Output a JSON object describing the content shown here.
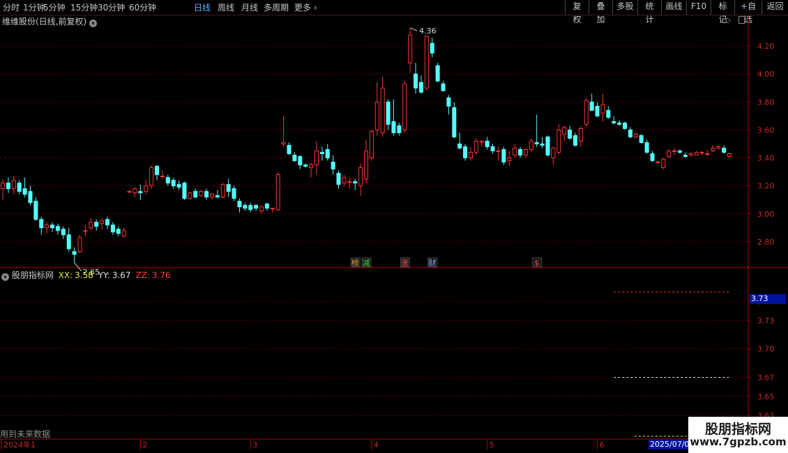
{
  "toolbar": {
    "periods": [
      "分时",
      "1分钟",
      "5分钟",
      "15分钟",
      "30分钟",
      "60分钟",
      "日线",
      "周线",
      "月线",
      "多周期",
      "更多"
    ],
    "active_period": "日线",
    "right_buttons": [
      "复权",
      "叠加",
      "多股",
      "统计",
      "画线",
      "F10",
      "标记",
      "+自选",
      "返回"
    ]
  },
  "main_panel": {
    "title": "维维股份(日线,前复权)",
    "high_label": "4.36",
    "low_label": "2.65",
    "event_badges": [
      {
        "text": "榜",
        "color": "#e0a040"
      },
      {
        "text": "减",
        "color": "#40d040"
      },
      {
        "text": "涨",
        "color": "#ff5050"
      },
      {
        "text": "财",
        "color": "#80a8ff"
      },
      {
        "text": "$",
        "color": "#ff4040"
      }
    ]
  },
  "indicator_panel": {
    "name": "股朋指标网",
    "xx_label": "XX:",
    "xx_value": "3.58",
    "yy_label": "YY:",
    "yy_value": "3.67",
    "zz_label": "ZZ:",
    "zz_value": "3.76",
    "current_value": "3.73",
    "footer_note": "用到未来数据"
  },
  "x_axis": {
    "labels": [
      "2024年1",
      "2",
      "3",
      "4",
      "5",
      "6"
    ],
    "current_date": "2025/07/0"
  },
  "watermark": {
    "line1": "股朋指标网",
    "line2": "www.7gpzb.com"
  },
  "colors": {
    "up": "#ff3232",
    "down": "#54ffff",
    "grid": "#7a0000",
    "active": "#5fb0ff"
  },
  "chart_data": {
    "type": "candlestick",
    "main_axis": {
      "ylim": [
        2.62,
        4.42
      ],
      "ticks": [
        "2.80",
        "3.00",
        "3.20",
        "3.40",
        "3.60",
        "3.80",
        "4.00",
        "4.20"
      ]
    },
    "indicator_axis": {
      "ylim": [
        3.605,
        3.785
      ],
      "ticks": [
        "3.63",
        "3.65",
        "3.67",
        "3.70",
        "3.73",
        "3.75"
      ]
    },
    "indicator_lines": {
      "XX": 3.58,
      "YY": 3.67,
      "ZZ": 3.76
    },
    "candles": [
      {
        "o": 3.18,
        "h": 3.25,
        "l": 3.1,
        "c": 3.22
      },
      {
        "o": 3.22,
        "h": 3.26,
        "l": 3.15,
        "c": 3.18
      },
      {
        "o": 3.18,
        "h": 3.27,
        "l": 3.14,
        "c": 3.24
      },
      {
        "o": 3.22,
        "h": 3.24,
        "l": 3.14,
        "c": 3.16
      },
      {
        "o": 3.18,
        "h": 3.26,
        "l": 3.12,
        "c": 3.14
      },
      {
        "o": 3.16,
        "h": 3.2,
        "l": 3.06,
        "c": 3.08
      },
      {
        "o": 3.09,
        "h": 3.12,
        "l": 2.95,
        "c": 2.96
      },
      {
        "o": 2.96,
        "h": 2.98,
        "l": 2.85,
        "c": 2.9
      },
      {
        "o": 2.9,
        "h": 2.94,
        "l": 2.86,
        "c": 2.92
      },
      {
        "o": 2.92,
        "h": 2.94,
        "l": 2.87,
        "c": 2.9
      },
      {
        "o": 2.91,
        "h": 2.93,
        "l": 2.85,
        "c": 2.88
      },
      {
        "o": 2.89,
        "h": 2.91,
        "l": 2.82,
        "c": 2.85
      },
      {
        "o": 2.85,
        "h": 2.9,
        "l": 2.73,
        "c": 2.75
      },
      {
        "o": 2.73,
        "h": 2.76,
        "l": 2.65,
        "c": 2.71
      },
      {
        "o": 2.73,
        "h": 2.85,
        "l": 2.72,
        "c": 2.83
      },
      {
        "o": 2.88,
        "h": 2.92,
        "l": 2.84,
        "c": 2.88
      },
      {
        "o": 2.9,
        "h": 2.97,
        "l": 2.88,
        "c": 2.94
      },
      {
        "o": 2.94,
        "h": 2.96,
        "l": 2.88,
        "c": 2.91
      },
      {
        "o": 2.93,
        "h": 2.97,
        "l": 2.89,
        "c": 2.95
      },
      {
        "o": 2.96,
        "h": 2.98,
        "l": 2.89,
        "c": 2.92
      },
      {
        "o": 2.92,
        "h": 2.94,
        "l": 2.85,
        "c": 2.87
      },
      {
        "o": 2.89,
        "h": 2.91,
        "l": 2.84,
        "c": 2.86
      },
      {
        "o": 2.84,
        "h": 2.9,
        "l": 2.83,
        "c": 2.88
      },
      {
        "o": 3.16,
        "h": 3.17,
        "l": 3.15,
        "c": 3.16
      },
      {
        "o": 3.15,
        "h": 3.19,
        "l": 3.12,
        "c": 3.18
      },
      {
        "o": 3.16,
        "h": 3.21,
        "l": 3.1,
        "c": 3.15
      },
      {
        "o": 3.16,
        "h": 3.24,
        "l": 3.14,
        "c": 3.2
      },
      {
        "o": 3.2,
        "h": 3.35,
        "l": 3.18,
        "c": 3.33
      },
      {
        "o": 3.34,
        "h": 3.35,
        "l": 3.24,
        "c": 3.28
      },
      {
        "o": 3.27,
        "h": 3.31,
        "l": 3.25,
        "c": 3.27
      },
      {
        "o": 3.26,
        "h": 3.28,
        "l": 3.2,
        "c": 3.22
      },
      {
        "o": 3.24,
        "h": 3.26,
        "l": 3.18,
        "c": 3.2
      },
      {
        "o": 3.21,
        "h": 3.24,
        "l": 3.17,
        "c": 3.19
      },
      {
        "o": 3.22,
        "h": 3.23,
        "l": 3.1,
        "c": 3.11
      },
      {
        "o": 3.11,
        "h": 3.16,
        "l": 3.1,
        "c": 3.15
      },
      {
        "o": 3.16,
        "h": 3.18,
        "l": 3.11,
        "c": 3.12
      },
      {
        "o": 3.13,
        "h": 3.17,
        "l": 3.12,
        "c": 3.16
      },
      {
        "o": 3.16,
        "h": 3.18,
        "l": 3.1,
        "c": 3.12
      },
      {
        "o": 3.12,
        "h": 3.15,
        "l": 3.1,
        "c": 3.14
      },
      {
        "o": 3.13,
        "h": 3.17,
        "l": 3.11,
        "c": 3.12
      },
      {
        "o": 3.12,
        "h": 3.22,
        "l": 3.11,
        "c": 3.21
      },
      {
        "o": 3.21,
        "h": 3.25,
        "l": 3.12,
        "c": 3.16
      },
      {
        "o": 3.18,
        "h": 3.2,
        "l": 3.09,
        "c": 3.11
      },
      {
        "o": 3.09,
        "h": 3.11,
        "l": 3.01,
        "c": 3.05
      },
      {
        "o": 3.06,
        "h": 3.08,
        "l": 3.02,
        "c": 3.04
      },
      {
        "o": 3.06,
        "h": 3.08,
        "l": 3.01,
        "c": 3.03
      },
      {
        "o": 3.06,
        "h": 3.07,
        "l": 3.02,
        "c": 3.04
      },
      {
        "o": 3.02,
        "h": 3.06,
        "l": 3.0,
        "c": 3.05
      },
      {
        "o": 3.07,
        "h": 3.08,
        "l": 3.02,
        "c": 3.04
      },
      {
        "o": 3.04,
        "h": 3.04,
        "l": 3.01,
        "c": 3.04
      },
      {
        "o": 3.03,
        "h": 3.3,
        "l": 3.02,
        "c": 3.28
      },
      {
        "o": 3.5,
        "h": 3.7,
        "l": 3.48,
        "c": 3.51
      },
      {
        "o": 3.49,
        "h": 3.51,
        "l": 3.42,
        "c": 3.43
      },
      {
        "o": 3.42,
        "h": 3.44,
        "l": 3.37,
        "c": 3.38
      },
      {
        "o": 3.41,
        "h": 3.42,
        "l": 3.32,
        "c": 3.35
      },
      {
        "o": 3.35,
        "h": 3.36,
        "l": 3.33,
        "c": 3.34
      },
      {
        "o": 3.33,
        "h": 3.37,
        "l": 3.26,
        "c": 3.35
      },
      {
        "o": 3.35,
        "h": 3.52,
        "l": 3.28,
        "c": 3.45
      },
      {
        "o": 3.44,
        "h": 3.48,
        "l": 3.38,
        "c": 3.43
      },
      {
        "o": 3.46,
        "h": 3.5,
        "l": 3.38,
        "c": 3.4
      },
      {
        "o": 3.37,
        "h": 3.42,
        "l": 3.28,
        "c": 3.32
      },
      {
        "o": 3.29,
        "h": 3.31,
        "l": 3.18,
        "c": 3.21
      },
      {
        "o": 3.22,
        "h": 3.28,
        "l": 3.2,
        "c": 3.26
      },
      {
        "o": 3.23,
        "h": 3.26,
        "l": 3.18,
        "c": 3.23
      },
      {
        "o": 3.23,
        "h": 3.25,
        "l": 3.17,
        "c": 3.22
      },
      {
        "o": 3.2,
        "h": 3.36,
        "l": 3.13,
        "c": 3.33
      },
      {
        "o": 3.25,
        "h": 3.53,
        "l": 3.22,
        "c": 3.45
      },
      {
        "o": 3.4,
        "h": 3.6,
        "l": 3.38,
        "c": 3.59
      },
      {
        "o": 3.6,
        "h": 3.94,
        "l": 3.56,
        "c": 3.8
      },
      {
        "o": 3.58,
        "h": 3.98,
        "l": 3.55,
        "c": 3.9
      },
      {
        "o": 3.8,
        "h": 3.82,
        "l": 3.6,
        "c": 3.64
      },
      {
        "o": 3.66,
        "h": 3.82,
        "l": 3.56,
        "c": 3.58
      },
      {
        "o": 3.63,
        "h": 3.65,
        "l": 3.56,
        "c": 3.58
      },
      {
        "o": 3.6,
        "h": 3.95,
        "l": 3.58,
        "c": 3.93
      },
      {
        "o": 4.08,
        "h": 4.33,
        "l": 4.01,
        "c": 4.28
      },
      {
        "o": 4.0,
        "h": 4.08,
        "l": 3.86,
        "c": 3.9
      },
      {
        "o": 3.94,
        "h": 3.99,
        "l": 3.86,
        "c": 3.87
      },
      {
        "o": 3.9,
        "h": 4.28,
        "l": 3.88,
        "c": 4.27
      },
      {
        "o": 4.22,
        "h": 4.26,
        "l": 4.12,
        "c": 4.15
      },
      {
        "o": 4.06,
        "h": 4.08,
        "l": 3.94,
        "c": 3.95
      },
      {
        "o": 3.93,
        "h": 3.95,
        "l": 3.88,
        "c": 3.88
      },
      {
        "o": 3.83,
        "h": 3.85,
        "l": 3.71,
        "c": 3.77
      },
      {
        "o": 3.76,
        "h": 3.8,
        "l": 3.54,
        "c": 3.55
      },
      {
        "o": 3.5,
        "h": 3.58,
        "l": 3.46,
        "c": 3.47
      },
      {
        "o": 3.48,
        "h": 3.5,
        "l": 3.38,
        "c": 3.4
      },
      {
        "o": 3.4,
        "h": 3.48,
        "l": 3.38,
        "c": 3.44
      },
      {
        "o": 3.44,
        "h": 3.54,
        "l": 3.42,
        "c": 3.52
      },
      {
        "o": 3.51,
        "h": 3.53,
        "l": 3.48,
        "c": 3.52
      },
      {
        "o": 3.52,
        "h": 3.55,
        "l": 3.46,
        "c": 3.48
      },
      {
        "o": 3.48,
        "h": 3.5,
        "l": 3.43,
        "c": 3.45
      },
      {
        "o": 3.45,
        "h": 3.48,
        "l": 3.38,
        "c": 3.45
      },
      {
        "o": 3.46,
        "h": 3.48,
        "l": 3.35,
        "c": 3.37
      },
      {
        "o": 3.38,
        "h": 3.45,
        "l": 3.34,
        "c": 3.4
      },
      {
        "o": 3.42,
        "h": 3.5,
        "l": 3.4,
        "c": 3.47
      },
      {
        "o": 3.46,
        "h": 3.48,
        "l": 3.4,
        "c": 3.42
      },
      {
        "o": 3.42,
        "h": 3.47,
        "l": 3.4,
        "c": 3.46
      },
      {
        "o": 3.46,
        "h": 3.54,
        "l": 3.44,
        "c": 3.52
      },
      {
        "o": 3.51,
        "h": 3.71,
        "l": 3.48,
        "c": 3.5
      },
      {
        "o": 3.5,
        "h": 3.55,
        "l": 3.47,
        "c": 3.49
      },
      {
        "o": 3.55,
        "h": 3.56,
        "l": 3.41,
        "c": 3.42
      },
      {
        "o": 3.4,
        "h": 3.48,
        "l": 3.35,
        "c": 3.47
      },
      {
        "o": 3.44,
        "h": 3.64,
        "l": 3.42,
        "c": 3.6
      },
      {
        "o": 3.57,
        "h": 3.63,
        "l": 3.52,
        "c": 3.62
      },
      {
        "o": 3.6,
        "h": 3.63,
        "l": 3.53,
        "c": 3.54
      },
      {
        "o": 3.56,
        "h": 3.58,
        "l": 3.48,
        "c": 3.49
      },
      {
        "o": 3.52,
        "h": 3.63,
        "l": 3.48,
        "c": 3.61
      },
      {
        "o": 3.64,
        "h": 3.83,
        "l": 3.62,
        "c": 3.81
      },
      {
        "o": 3.8,
        "h": 3.86,
        "l": 3.74,
        "c": 3.74
      },
      {
        "o": 3.77,
        "h": 3.8,
        "l": 3.69,
        "c": 3.7
      },
      {
        "o": 3.72,
        "h": 3.86,
        "l": 3.66,
        "c": 3.78
      },
      {
        "o": 3.74,
        "h": 3.77,
        "l": 3.68,
        "c": 3.69
      },
      {
        "o": 3.66,
        "h": 3.7,
        "l": 3.64,
        "c": 3.65
      },
      {
        "o": 3.65,
        "h": 3.67,
        "l": 3.63,
        "c": 3.64
      },
      {
        "o": 3.65,
        "h": 3.66,
        "l": 3.6,
        "c": 3.61
      },
      {
        "o": 3.6,
        "h": 3.62,
        "l": 3.54,
        "c": 3.55
      },
      {
        "o": 3.55,
        "h": 3.58,
        "l": 3.54,
        "c": 3.57
      },
      {
        "o": 3.56,
        "h": 3.57,
        "l": 3.5,
        "c": 3.51
      },
      {
        "o": 3.51,
        "h": 3.53,
        "l": 3.43,
        "c": 3.44
      },
      {
        "o": 3.43,
        "h": 3.45,
        "l": 3.37,
        "c": 3.38
      },
      {
        "o": 3.37,
        "h": 3.38,
        "l": 3.35,
        "c": 3.37
      },
      {
        "o": 3.33,
        "h": 3.4,
        "l": 3.32,
        "c": 3.39
      },
      {
        "o": 3.41,
        "h": 3.46,
        "l": 3.4,
        "c": 3.45
      },
      {
        "o": 3.45,
        "h": 3.47,
        "l": 3.42,
        "c": 3.45
      },
      {
        "o": 3.45,
        "h": 3.46,
        "l": 3.43,
        "c": 3.44
      },
      {
        "o": 3.42,
        "h": 3.44,
        "l": 3.4,
        "c": 3.41
      },
      {
        "o": 3.42,
        "h": 3.44,
        "l": 3.41,
        "c": 3.43
      },
      {
        "o": 3.42,
        "h": 3.45,
        "l": 3.42,
        "c": 3.44
      },
      {
        "o": 3.44,
        "h": 3.45,
        "l": 3.42,
        "c": 3.44
      },
      {
        "o": 3.43,
        "h": 3.46,
        "l": 3.41,
        "c": 3.43
      },
      {
        "o": 3.45,
        "h": 3.49,
        "l": 3.44,
        "c": 3.47
      },
      {
        "o": 3.47,
        "h": 3.49,
        "l": 3.46,
        "c": 3.48
      },
      {
        "o": 3.47,
        "h": 3.49,
        "l": 3.43,
        "c": 3.44
      },
      {
        "o": 3.41,
        "h": 3.44,
        "l": 3.4,
        "c": 3.43
      }
    ]
  }
}
